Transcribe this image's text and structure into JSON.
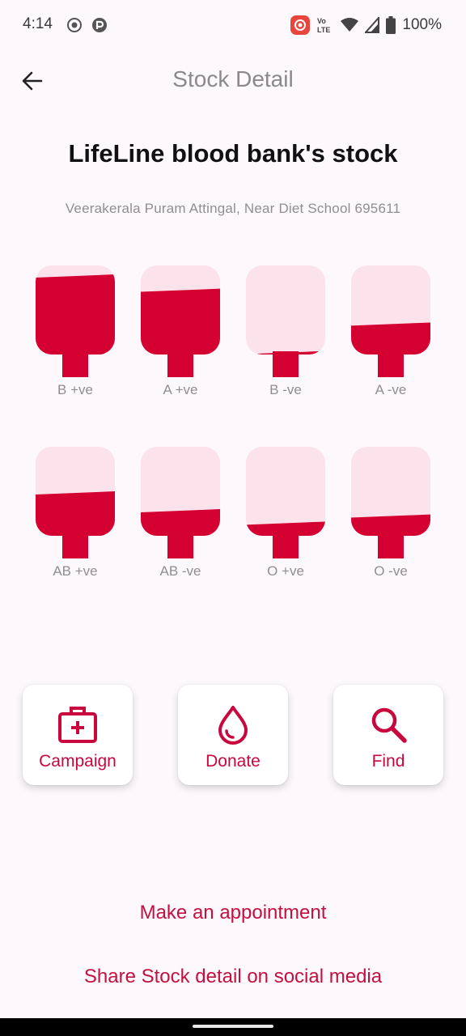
{
  "status_bar": {
    "time": "4:14",
    "battery": "100%",
    "left_icons": [
      "record-icon",
      "app-notification-icon"
    ],
    "right_icons": [
      "screen-record-icon",
      "volte-icon",
      "wifi-icon",
      "signal-icon",
      "battery-icon"
    ],
    "volte_text": "Vo LTE"
  },
  "app_bar": {
    "title": "Stock Detail",
    "back_icon": "arrow-back-icon"
  },
  "bank": {
    "name": "LifeLine blood bank's stock",
    "address": "Veerakerala Puram Attingal, Near Diet School 695611"
  },
  "blood_stock": [
    {
      "label": "B +ve",
      "level": 0.9
    },
    {
      "label": "A +ve",
      "level": 0.74
    },
    {
      "label": "B -ve",
      "level": 0.04
    },
    {
      "label": "A -ve",
      "level": 0.36
    },
    {
      "label": "AB +ve",
      "level": 0.5
    },
    {
      "label": "AB -ve",
      "level": 0.3
    },
    {
      "label": "O +ve",
      "level": 0.16
    },
    {
      "label": "O -ve",
      "level": 0.24
    }
  ],
  "colors": {
    "blood": "#d40032",
    "bag_empty": "#fce2ea",
    "accent": "#c8073e"
  },
  "actions": [
    {
      "label": "Campaign",
      "icon": "medical-kit-icon"
    },
    {
      "label": "Donate",
      "icon": "blood-drop-icon"
    },
    {
      "label": "Find",
      "icon": "search-icon"
    }
  ],
  "links": {
    "appointment": "Make an appointment",
    "share": "Share Stock detail on social media"
  }
}
